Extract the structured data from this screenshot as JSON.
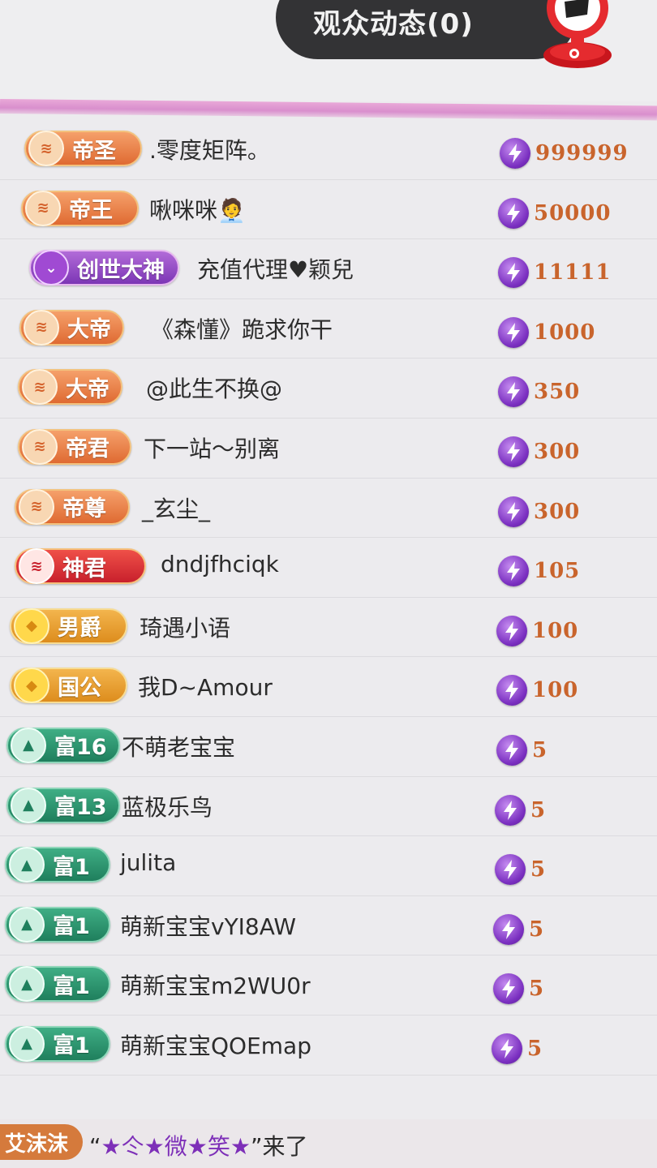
{
  "header": {
    "title": "观众动态(0)"
  },
  "viewers": [
    {
      "badge": "帝圣",
      "badge_style": "orange",
      "name": ".零度矩阵。",
      "amount": "999999"
    },
    {
      "badge": "帝王",
      "badge_style": "orange",
      "name": "啾咪咪🧑‍💼",
      "amount": "50000"
    },
    {
      "badge": "创世大神",
      "badge_style": "purple",
      "name": "充值代理♥颖兒",
      "amount": "11111"
    },
    {
      "badge": "大帝",
      "badge_style": "orange",
      "name": "《森懂》跪求你干",
      "amount": "1000"
    },
    {
      "badge": "大帝",
      "badge_style": "orange",
      "name": "@此生不换@",
      "amount": "350"
    },
    {
      "badge": "帝君",
      "badge_style": "orange",
      "name": "下一站～别离",
      "amount": "300"
    },
    {
      "badge": "帝尊",
      "badge_style": "orange",
      "name": "_玄尘_",
      "amount": "300"
    },
    {
      "badge": "神君",
      "badge_style": "red",
      "name": "dndjfhciqk",
      "amount": "105"
    },
    {
      "badge": "男爵",
      "badge_style": "gold",
      "name": "琦遇小语",
      "amount": "100"
    },
    {
      "badge": "国公",
      "badge_style": "gold",
      "name": "我D~Amour",
      "amount": "100"
    },
    {
      "badge": "富16",
      "badge_style": "green",
      "name": "不萌老宝宝",
      "amount": "5"
    },
    {
      "badge": "富13",
      "badge_style": "green",
      "name": "蓝极乐鸟",
      "amount": "5"
    },
    {
      "badge": "富1",
      "badge_style": "green",
      "name": "julita",
      "amount": "5"
    },
    {
      "badge": "富1",
      "badge_style": "green",
      "name": "萌新宝宝vYI8AW",
      "amount": "5"
    },
    {
      "badge": "富1",
      "badge_style": "green",
      "name": "萌新宝宝m2WU0r",
      "amount": "5"
    },
    {
      "badge": "富1",
      "badge_style": "green",
      "name": "萌新宝宝QOEmap",
      "amount": "5"
    }
  ],
  "arrival": {
    "tag": "艾沫沫",
    "prefix": "“",
    "name": "★仒★微★笑★",
    "suffix": "”来了"
  },
  "colors": {
    "title_pill": "#333335",
    "accent_line": "#d98fcd",
    "amount": "#c9642c",
    "coin": "#7a2fc0"
  }
}
